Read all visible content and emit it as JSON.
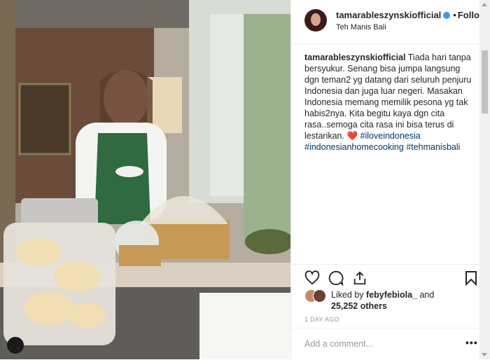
{
  "header": {
    "username": "tamarableszynskiofficial",
    "follow_label": "Following",
    "dot": "•",
    "location": "Teh Manis Bali"
  },
  "caption": {
    "username": "tamarableszynskiofficial",
    "text": "Tiada hari tanpa bersyukur. Senang bisa jumpa langsung dgn teman2 yg datang dari seluruh penjuru Indonesia dan juga luar negeri. Masakan Indonesia memang memilik pesona yg tak habis2nya. Kita begitu kaya dgn cita rasa..semoga cita rasa ini bisa terus di lestarikan.",
    "emoji": "❤️",
    "hashtags": [
      "#iloveindonesia",
      "#indonesianhomecooking",
      "#tehmanisbali"
    ]
  },
  "likes": {
    "prefix": "Liked by",
    "user": "febyfebiola_",
    "connector": "and",
    "count": "25,252 others"
  },
  "time": "1 DAY AGO",
  "comment": {
    "placeholder": "Add a comment..."
  },
  "more_label": "•••",
  "icons": [
    "heart-icon",
    "comment-icon",
    "share-icon",
    "bookmark-icon",
    "verified-badge-icon"
  ]
}
